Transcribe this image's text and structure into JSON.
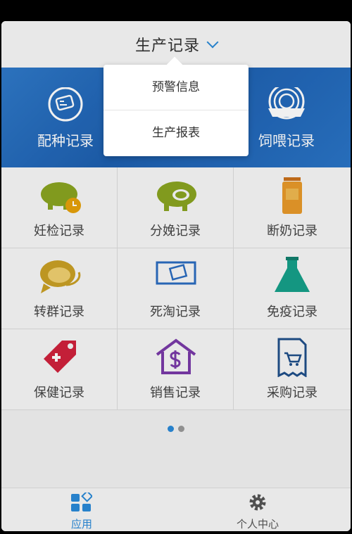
{
  "header": {
    "title": "生产记录"
  },
  "banner": {
    "left_label": "配种记录",
    "right_label": "饲喂记录"
  },
  "grid": [
    {
      "label": "妊检记录",
      "icon": "pregnant-pig-clock-icon"
    },
    {
      "label": "分娩记录",
      "icon": "piglet-pig-icon"
    },
    {
      "label": "断奶记录",
      "icon": "milk-bottle-icon"
    },
    {
      "label": "转群记录",
      "icon": "pig-chat-icon"
    },
    {
      "label": "死淘记录",
      "icon": "monitor-ticket-icon"
    },
    {
      "label": "免疫记录",
      "icon": "vaccine-flask-icon"
    },
    {
      "label": "保健记录",
      "icon": "health-tag-icon"
    },
    {
      "label": "销售记录",
      "icon": "dollar-house-icon"
    },
    {
      "label": "采购记录",
      "icon": "receipt-cart-icon"
    }
  ],
  "pagination": {
    "pages": 2,
    "current": 1
  },
  "dropdown": {
    "items": [
      "预警信息",
      "生产报表"
    ]
  },
  "tabbar": {
    "apps_label": "应用",
    "profile_label": "个人中心",
    "active_color": "#2a8ad8"
  }
}
